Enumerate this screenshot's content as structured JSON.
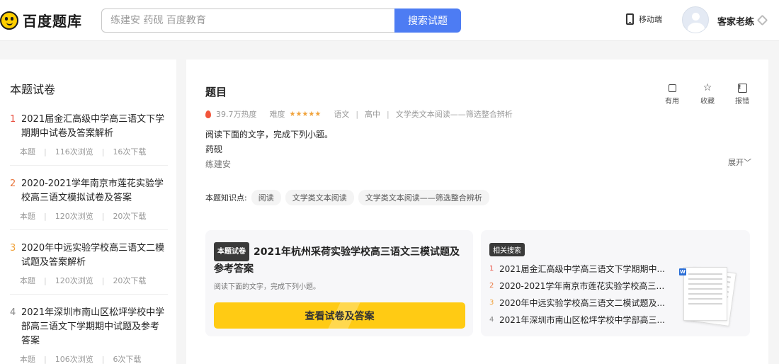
{
  "header": {
    "logo_text": "百度题库",
    "search_placeholder": "练建安 药砚 百度教育",
    "search_button": "搜索试题",
    "mobile_label": "移动端",
    "username": "客家老练"
  },
  "sidebar": {
    "title": "本题试卷",
    "papers": [
      {
        "num": "1",
        "title": "2021届金汇高级中学高三语文下学期期中试卷及答案解析",
        "tag": "本题",
        "views": "116次浏览",
        "downloads": "16次下载"
      },
      {
        "num": "2",
        "title": "2020-2021学年南京市莲花实验学校高三语文模拟试卷及答案",
        "tag": "本题",
        "views": "120次浏览",
        "downloads": "20次下载"
      },
      {
        "num": "3",
        "title": "2020年中远实验学校高三语文二模试题及答案解析",
        "tag": "本题",
        "views": "120次浏览",
        "downloads": "20次下载"
      },
      {
        "num": "4",
        "title": "2021年深圳市南山区松坪学校中学部高三语文下学期期中试题及参考答案",
        "tag": "本题",
        "views": "106次浏览",
        "downloads": "6次下载"
      }
    ]
  },
  "question": {
    "title": "题目",
    "heat": "39.7万热度",
    "difficulty_label": "难度",
    "stars": "★★★★★",
    "subject": "语文",
    "level": "高中",
    "category": "文学类文本阅读——筛选整合辨析",
    "text_line1": "阅读下面的文字，完成下列小题。",
    "text_line2": "药砚",
    "author": "练建安",
    "expand_label": "展开",
    "actions": {
      "useful": "有用",
      "favorite": "收藏",
      "report": "报错"
    },
    "knowledge_label": "本题知识点:",
    "knowledge_tags": [
      "阅读",
      "文学类文本阅读",
      "文学类文本阅读——筛选整合辨析"
    ]
  },
  "paper_card": {
    "badge": "本题试卷",
    "title": "2021年杭州采荷实验学校高三语文三模试题及参考答案",
    "desc": "阅读下面的文字，完成下列小题。",
    "button": "查看试卷及答案"
  },
  "related_card": {
    "badge": "相关搜索",
    "items": [
      {
        "num": "1",
        "title": "2021届金汇高级中学高三语文下学期期中..."
      },
      {
        "num": "2",
        "title": "2020-2021学年南京市莲花实验学校高三语..."
      },
      {
        "num": "3",
        "title": "2020年中远实验学校高三语文二模试题及..."
      },
      {
        "num": "4",
        "title": "2021年深圳市南山区松坪学校中学部高三..."
      }
    ]
  },
  "colors": {
    "accent_blue": "#4d7cf3",
    "brand_yellow": "#ffcb14",
    "rank_1": "#e84c3d",
    "rank_2": "#e8763d",
    "rank_3": "#f0a23a"
  }
}
